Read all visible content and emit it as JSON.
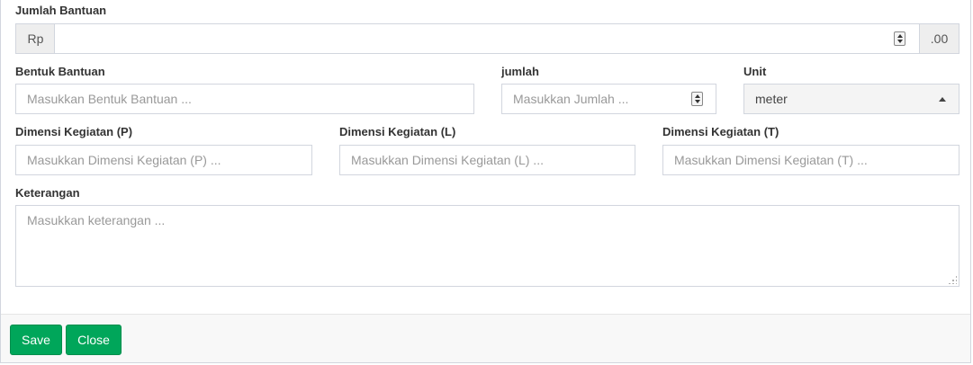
{
  "form": {
    "jumlah_bantuan": {
      "label": "Jumlah Bantuan",
      "prefix": "Rp",
      "suffix": ".00",
      "value": ""
    },
    "bentuk_bantuan": {
      "label": "Bentuk Bantuan",
      "placeholder": "Masukkan Bentuk Bantuan ..."
    },
    "jumlah": {
      "label": "jumlah",
      "placeholder": "Masukkan Jumlah ..."
    },
    "unit": {
      "label": "Unit",
      "selected": "meter"
    },
    "dimensi_p": {
      "label": "Dimensi Kegiatan (P)",
      "placeholder": "Masukkan Dimensi Kegiatan (P) ..."
    },
    "dimensi_l": {
      "label": "Dimensi Kegiatan (L)",
      "placeholder": "Masukkan Dimensi Kegiatan (L) ..."
    },
    "dimensi_t": {
      "label": "Dimensi Kegiatan (T)",
      "placeholder": "Masukkan Dimensi Kegiatan (T) ..."
    },
    "keterangan": {
      "label": "Keterangan",
      "placeholder": "Masukkan keterangan ..."
    }
  },
  "footer": {
    "save_label": "Save",
    "close_label": "Close"
  },
  "colors": {
    "button_green": "#00a65a",
    "border": "#d2d6de",
    "addon_bg": "#eeeeee"
  }
}
